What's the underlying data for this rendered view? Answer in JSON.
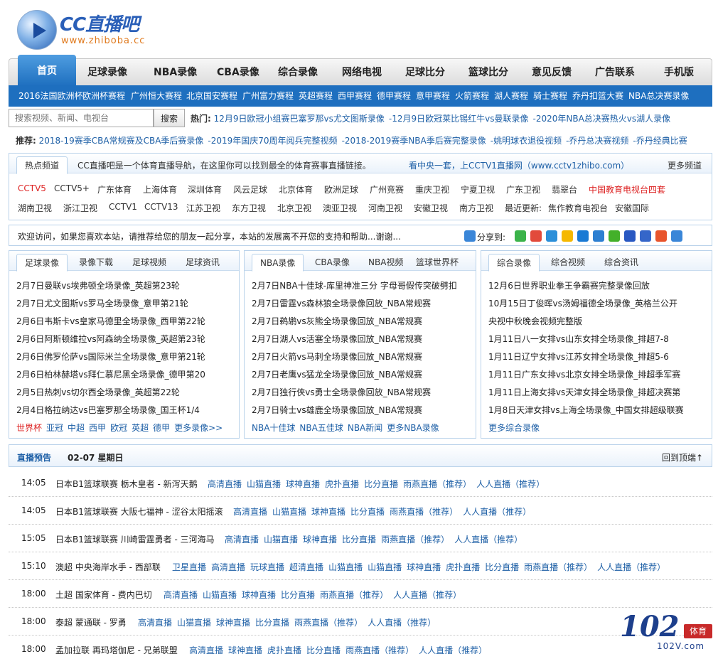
{
  "header": {
    "logo_title": "CC直播吧",
    "logo_url": "www.zhiboba.cc"
  },
  "nav": [
    "首页",
    "足球录像",
    "NBA录像",
    "CBA录像",
    "综合录像",
    "网络电视",
    "足球比分",
    "篮球比分",
    "意见反馈",
    "广告联系",
    "手机版"
  ],
  "subnav": [
    "2016法国欧洲杯",
    "欧洲杯赛程",
    "广州恒大赛程",
    "北京国安赛程",
    "广州富力赛程",
    "英超赛程",
    "西甲赛程",
    "德甲赛程",
    "意甲赛程",
    "火箭赛程",
    "湖人赛程",
    "骑士赛程",
    "乔丹扣篮大赛",
    "NBA总决赛录像"
  ],
  "search": {
    "placeholder": "搜索视频、新闻、电视台",
    "button": "搜索"
  },
  "hot": {
    "label": "热门:",
    "items": [
      "12月9日欧冠小组赛巴塞罗那vs尤文图斯录像",
      "-12月9日欧冠莱比锡红牛vs曼联录像",
      "-2020年NBA总决赛热火vs湖人录像"
    ]
  },
  "recommend": {
    "label": "推荐:",
    "items": [
      "2018-19赛季CBA常规赛及CBA季后赛录像",
      "-2019年国庆70周年阅兵完整视频",
      "-2018-2019赛季NBA季后赛完整录像",
      "-姚明球衣退役视频",
      "-乔丹总决赛视频",
      "-乔丹经典比赛"
    ]
  },
  "channels": {
    "tab": "热点频道",
    "intro": "CC直播吧是一个体育直播导航，在这里你可以找到最全的体育赛事直播链接。",
    "cctv_note": "看中央一套，上CCTV1直播网（www.cctv1zhibo.com）",
    "more": "更多频道",
    "row1": [
      "CCTV5",
      "CCTV5+",
      "广东体育",
      "上海体育",
      "深圳体育",
      "风云足球",
      "北京体育",
      "欧洲足球",
      "广州竞赛",
      "重庆卫视",
      "宁夏卫视",
      "广东卫视",
      "翡翠台",
      "中国教育电视台四套"
    ],
    "row2": [
      "湖南卫视",
      "浙江卫视",
      "CCTV1",
      "CCTV13",
      "江苏卫视",
      "东方卫视",
      "北京卫视",
      "澳亚卫视",
      "河南卫视",
      "安徽卫视",
      "南方卫视",
      "最近更新:",
      "焦作教育电视台",
      "安徽国际"
    ]
  },
  "share": {
    "welcome": "欢迎访问，如果您喜欢本站，请推荐给您的朋友一起分享，本站的发展离不开您的支持和帮助...谢谢...",
    "label": "分享到:"
  },
  "col1": {
    "tabs": [
      "足球录像",
      "录像下载",
      "足球视频",
      "足球资讯"
    ],
    "items": [
      "2月7日曼联vs埃弗顿全场录像_英超第23轮",
      "2月7日尤文图斯vs罗马全场录像_意甲第21轮",
      "2月6日韦斯卡vs皇家马德里全场录像_西甲第22轮",
      "2月6日阿斯顿维拉vs阿森纳全场录像_英超第23轮",
      "2月6日佛罗伦萨vs国际米兰全场录像_意甲第21轮",
      "2月6日柏林赫塔vs拜仁慕尼黑全场录像_德甲第20",
      "2月5日热刺vs切尔西全场录像_英超第22轮",
      "2月4日格拉纳达vs巴塞罗那全场录像_国王杯1/4"
    ],
    "foot": [
      "世界杯",
      "亚冠",
      "中超",
      "西甲",
      "欧冠",
      "英超",
      "德甲",
      "更多录像>>"
    ]
  },
  "col2": {
    "tabs": [
      "NBA录像",
      "CBA录像",
      "NBA视频",
      "篮球世界杯"
    ],
    "items": [
      "2月7日NBA十佳球-库里神准三分 字母哥假传突破劈扣",
      "2月7日雷霆vs森林狼全场录像回放_NBA常规赛",
      "2月7日鹈鹕vs灰熊全场录像回放_NBA常规赛",
      "2月7日湖人vs活塞全场录像回放_NBA常规赛",
      "2月7日火箭vs马刺全场录像回放_NBA常规赛",
      "2月7日老鹰vs猛龙全场录像回放_NBA常规赛",
      "2月7日独行侠vs勇士全场录像回放_NBA常规赛",
      "2月7日骑士vs雄鹿全场录像回放_NBA常规赛"
    ],
    "foot": [
      "NBA十佳球",
      "NBA五佳球",
      "NBA新闻",
      "更多NBA录像"
    ]
  },
  "col3": {
    "tabs": [
      "综合录像",
      "综合视频",
      "综合资讯"
    ],
    "items": [
      "12月6日世界职业拳王争霸赛完整录像回放",
      "10月15日丁俊晖vs汤姆福德全场录像_英格兰公开",
      "央视中秋晚会视频完整版",
      "1月11日八一女排vs山东女排全场录像_排超7-8",
      "1月11日辽宁女排vs江苏女排全场录像_排超5-6",
      "1月11日广东女排vs北京女排全场录像_排超季军赛",
      "1月11日上海女排vs天津女排全场录像_排超决赛第",
      "1月8日天津女排vs上海全场录像_中国女排超级联赛"
    ],
    "foot": [
      "更多综合录像"
    ]
  },
  "schedule": {
    "label": "直播预告",
    "date": "02-07 星期日",
    "back_top": "回到顶端↑",
    "rows": [
      {
        "time": "14:05",
        "title": "日本B1篮球联赛 栃木皇者 - 新泻天鹅",
        "links": [
          "高清直播",
          "山猫直播",
          "球神直播",
          "虎扑直播",
          "比分直播",
          "雨燕直播（推荐）",
          "人人直播（推荐）"
        ]
      },
      {
        "time": "14:05",
        "title": "日本B1篮球联赛 大阪七福神 - 涩谷太阳摇滚",
        "links": [
          "高清直播",
          "山猫直播",
          "球神直播",
          "比分直播",
          "雨燕直播（推荐）",
          "人人直播（推荐）"
        ]
      },
      {
        "time": "15:05",
        "title": "日本B1篮球联赛 川崎雷霆勇者 - 三河海马",
        "links": [
          "高清直播",
          "山猫直播",
          "球神直播",
          "比分直播",
          "雨燕直播（推荐）",
          "人人直播（推荐）"
        ]
      },
      {
        "time": "15:10",
        "title": "澳超 中央海岸水手 - 西部联",
        "links": [
          "卫星直播",
          "高清直播",
          "玩球直播",
          "超清直播",
          "山猫直播",
          "山猫直播",
          "球神直播",
          "虎扑直播",
          "比分直播",
          "雨燕直播（推荐）",
          "人人直播（推荐）"
        ]
      },
      {
        "time": "18:00",
        "title": "土超 国家体育 - 费内巴切",
        "links": [
          "高清直播",
          "山猫直播",
          "球神直播",
          "比分直播",
          "雨燕直播（推荐）",
          "人人直播（推荐）"
        ]
      },
      {
        "time": "18:00",
        "title": "泰超 蒙通联 - 罗勇",
        "links": [
          "高清直播",
          "山猫直播",
          "球神直播",
          "比分直播",
          "雨燕直播（推荐）",
          "人人直播（推荐）"
        ]
      },
      {
        "time": "18:00",
        "title": "孟加拉联 再玛塔伽尼 - 兄弟联盟",
        "links": [
          "高清直播",
          "球神直播",
          "虎扑直播",
          "比分直播",
          "雨燕直播（推荐）",
          "人人直播（推荐）"
        ]
      }
    ]
  },
  "watermark": {
    "big": "102",
    "tag": "体育",
    "url": "102V.com"
  },
  "colors": {
    "brand_blue": "#1e6fbf",
    "link": "#1d5fa6",
    "accent_red": "#dd2222"
  }
}
